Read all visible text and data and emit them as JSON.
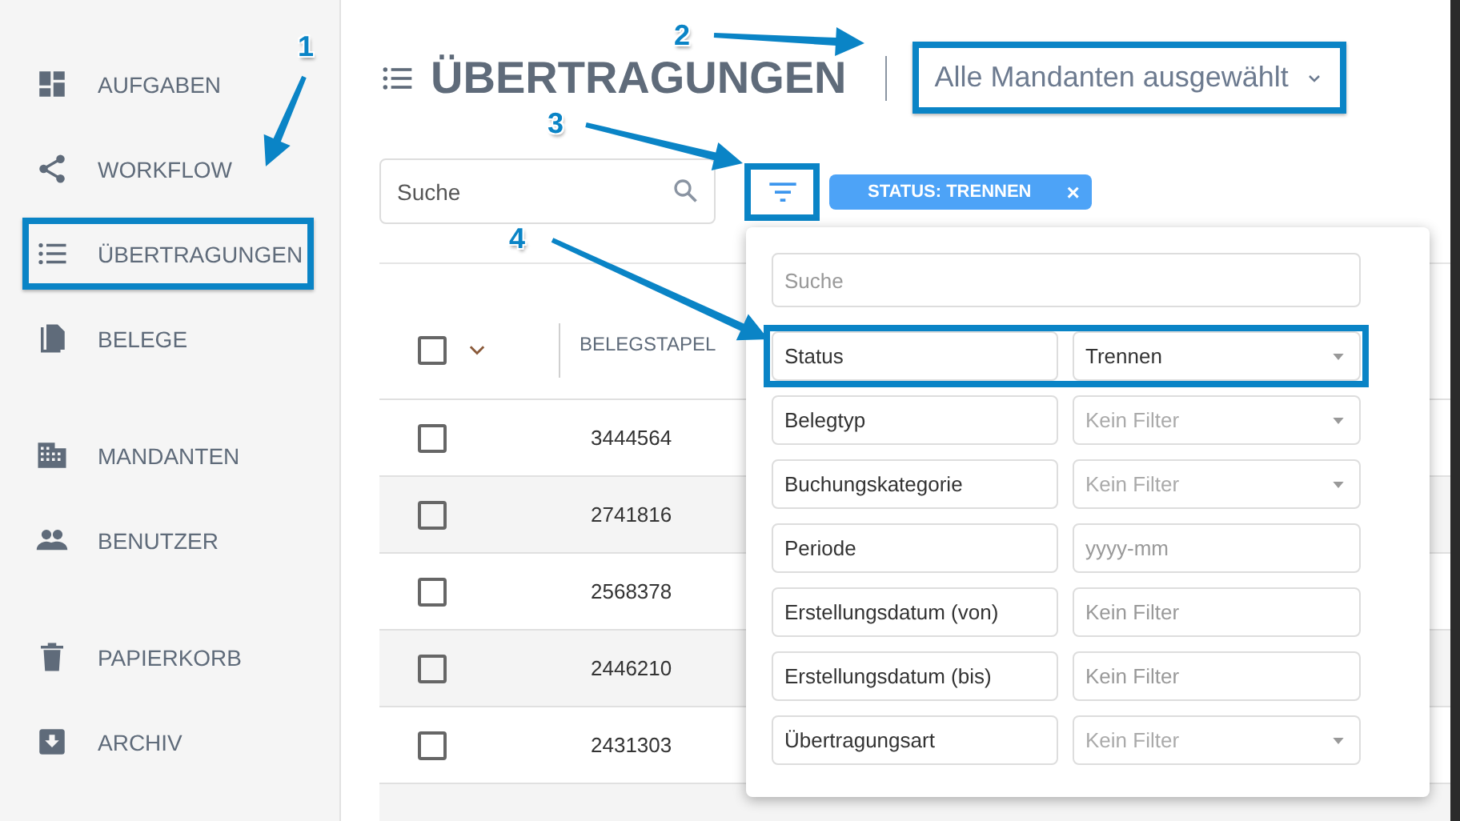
{
  "sidebar": {
    "groups": [
      {
        "items": [
          {
            "label": "AUFGABEN",
            "highlighted": false
          },
          {
            "label": "WORKFLOW",
            "highlighted": false
          },
          {
            "label": "ÜBERTRAGUNGEN",
            "highlighted": true
          },
          {
            "label": "BELEGE",
            "highlighted": false
          }
        ]
      },
      {
        "items": [
          {
            "label": "MANDANTEN",
            "highlighted": false
          },
          {
            "label": "BENUTZER",
            "highlighted": false
          }
        ]
      },
      {
        "items": [
          {
            "label": "PAPIERKORB",
            "highlighted": false
          },
          {
            "label": "ARCHIV",
            "highlighted": false
          }
        ]
      }
    ]
  },
  "header": {
    "title": "ÜBERTRAGUNGEN",
    "client_dropdown": {
      "value": "Alle Mandanten ausgewählt",
      "highlighted": true
    }
  },
  "toolbar": {
    "search": {
      "placeholder": "Suche"
    },
    "filter_button": {
      "highlighted": true
    },
    "chips": [
      {
        "label": "STATUS: TRENNEN",
        "close": "×"
      }
    ]
  },
  "table": {
    "columns": [
      "BELEGSTAPEL"
    ],
    "select_all": {
      "checked": false
    },
    "rows": [
      {
        "checked": false,
        "cells": [
          "3444564"
        ]
      },
      {
        "checked": false,
        "cells": [
          "2741816"
        ]
      },
      {
        "checked": false,
        "cells": [
          "2568378"
        ]
      },
      {
        "checked": false,
        "cells": [
          "2446210"
        ]
      },
      {
        "checked": false,
        "cells": [
          "2431303"
        ]
      }
    ]
  },
  "filter_panel": {
    "search": {
      "placeholder": "Suche"
    },
    "rows": [
      {
        "label": "Status",
        "kind": "select",
        "value": "Trennen",
        "highlighted": true
      },
      {
        "label": "Belegtyp",
        "kind": "select",
        "placeholder": "Kein Filter",
        "highlighted": false
      },
      {
        "label": "Buchungskategorie",
        "kind": "select",
        "placeholder": "Kein Filter",
        "highlighted": false
      },
      {
        "label": "Periode",
        "kind": "input",
        "placeholder": "yyyy-mm",
        "highlighted": false
      },
      {
        "label": "Erstellungsdatum (von)",
        "kind": "input",
        "placeholder": "Kein Filter",
        "highlighted": false
      },
      {
        "label": "Erstellungsdatum (bis)",
        "kind": "input",
        "placeholder": "Kein Filter",
        "highlighted": false
      },
      {
        "label": "Übertragungsart",
        "kind": "select",
        "placeholder": "Kein Filter",
        "highlighted": false
      }
    ]
  },
  "callouts": [
    {
      "label": "1"
    },
    {
      "label": "2"
    },
    {
      "label": "3"
    },
    {
      "label": "4"
    }
  ]
}
